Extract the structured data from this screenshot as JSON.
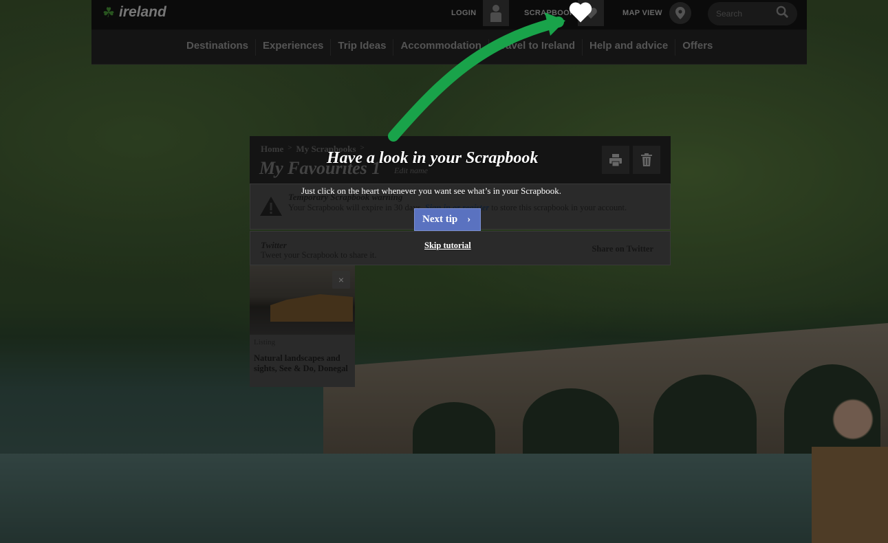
{
  "header": {
    "logo_text": "ireland",
    "login_label": "LOGIN",
    "scrapbook_label": "SCRAPBOOK",
    "mapview_label": "MAP VIEW",
    "search_placeholder": "Search"
  },
  "nav": {
    "items": [
      "Destinations",
      "Experiences",
      "Trip Ideas",
      "Accommodation",
      "Travel to Ireland",
      "Help and advice",
      "Offers"
    ]
  },
  "breadcrumb": {
    "home": "Home",
    "scrapbooks": "My Scrapbooks",
    "separator": ">"
  },
  "page": {
    "title": "My Favourites 1",
    "edit_name": "Edit name"
  },
  "warning": {
    "title": "Temporary Scrapbook warning",
    "text_before": "Your Scrapbook will expire in 30 days.",
    "link": "Sign in or register",
    "text_after": "to store this scrapbook in your account."
  },
  "twitter": {
    "title": "Twitter",
    "text": "Tweet your Scrapbook to share it.",
    "button": "Share on Twitter"
  },
  "card": {
    "type": "Listing",
    "title": "Natural landscapes and sights, See & Do, Donegal",
    "close": "×"
  },
  "tutorial": {
    "title": "Have a look in your Scrapbook",
    "text": "Just click on the heart whenever you want see what’s in your Scrapbook.",
    "next_label": "Next tip",
    "next_icon": "›",
    "skip_label": "Skip tutorial"
  },
  "colors": {
    "arrow": "#19a34a",
    "next_button": "#5a72c0",
    "brand_green": "#4a9a3a"
  },
  "icons": [
    "shamrock-icon",
    "person-icon",
    "heart-icon",
    "map-pin-icon",
    "search-icon",
    "print-icon",
    "trash-icon",
    "warning-icon",
    "close-icon",
    "chevron-right-icon"
  ]
}
